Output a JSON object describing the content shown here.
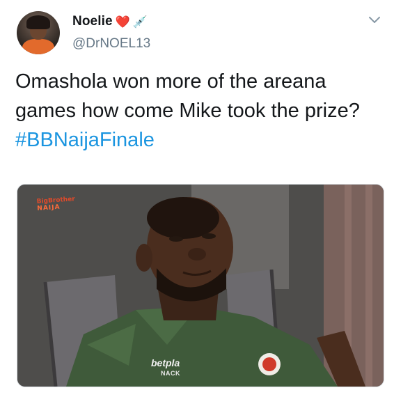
{
  "tweet": {
    "display_name": "Noelie",
    "name_emojis": [
      "❤️",
      "💉"
    ],
    "handle": "@DrNOEL13",
    "text_plain": "Omashola won more of the areana games how come Mike took the prize? ",
    "hashtag": "#BBNaijaFinale",
    "menu_icon": "chevron-down-icon"
  },
  "media": {
    "watermark_line1": "BigBrother",
    "watermark_line2": "NAIJA",
    "shirt_brand": "betpla",
    "shirt_sub": "NACK"
  },
  "colors": {
    "text": "#14171a",
    "secondary": "#657786",
    "link": "#1b95e0",
    "heart": "#e0245e"
  }
}
